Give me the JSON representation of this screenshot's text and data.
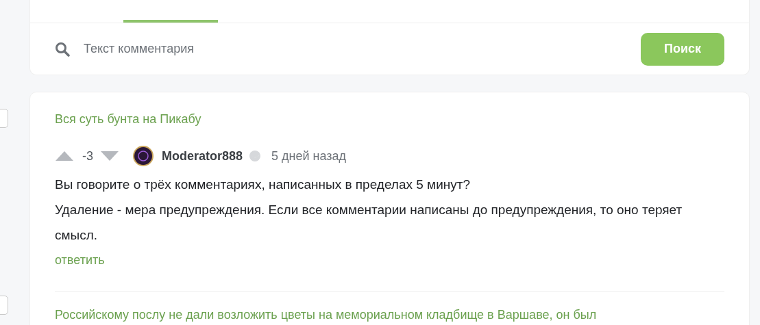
{
  "tabs": [
    {
      "selected": false
    },
    {
      "selected": true
    }
  ],
  "search": {
    "placeholder": "Текст комментария",
    "button": "Поиск"
  },
  "comments": [
    {
      "post_title": "Вся суть бунта на Пикабу",
      "rating": "-3",
      "author": "Moderator888",
      "time": "5 дней назад",
      "paragraphs": [
        "Вы говорите о трёх комментариях, написанных в пределах 5 минут?",
        "Удаление - мера предупреждения. Если все комментарии написаны до предупреждения, то оно теряет смысл."
      ],
      "reply": "ответить"
    },
    {
      "post_title": "Российскому послу не дали возложить цветы на мемориальном кладбище в Варшаве, он был"
    }
  ]
}
